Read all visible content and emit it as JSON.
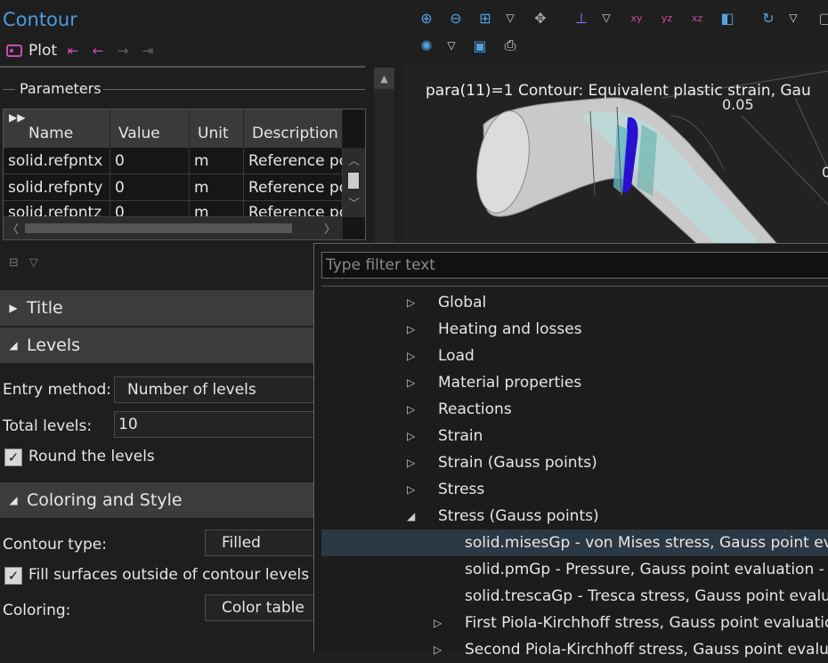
{
  "settings": {
    "title": "Contour",
    "plot_label": "Plot",
    "parameters_heading": "Parameters",
    "table": {
      "headers": [
        "Name",
        "Value",
        "Unit",
        "Description"
      ],
      "rows": [
        [
          "solid.refpntx",
          "0",
          "m",
          "Reference poi"
        ],
        [
          "solid.refpnty",
          "0",
          "m",
          "Reference poi"
        ],
        [
          "solid.refpntz",
          "0",
          "m",
          "Reference poi"
        ]
      ]
    },
    "sections": {
      "title": "Title",
      "levels": "Levels",
      "coloring": "Coloring and Style"
    },
    "levels": {
      "entry_method_label": "Entry method:",
      "entry_method_value": "Number of levels",
      "total_levels_label": "Total levels:",
      "total_levels_value": "10",
      "round_label": "Round the levels",
      "round_checked": true
    },
    "coloring": {
      "contour_type_label": "Contour type:",
      "contour_type_value": "Filled",
      "fill_label": "Fill surfaces outside of contour levels",
      "fill_checked": true,
      "coloring_label": "Coloring:",
      "coloring_value": "Color table"
    }
  },
  "graphics": {
    "plot_title": "para(11)=1  Contour: Equivalent plastic strain, Gau",
    "tick_a": "0.05",
    "tick_b": "0"
  },
  "popup": {
    "filter_placeholder": "Type filter text",
    "tree": [
      {
        "label": "Global",
        "level": 0,
        "state": "collapsed"
      },
      {
        "label": "Heating and losses",
        "level": 0,
        "state": "collapsed"
      },
      {
        "label": "Load",
        "level": 0,
        "state": "collapsed"
      },
      {
        "label": "Material properties",
        "level": 0,
        "state": "collapsed"
      },
      {
        "label": "Reactions",
        "level": 0,
        "state": "collapsed"
      },
      {
        "label": "Strain",
        "level": 0,
        "state": "collapsed"
      },
      {
        "label": "Strain (Gauss points)",
        "level": 0,
        "state": "collapsed"
      },
      {
        "label": "Stress",
        "level": 0,
        "state": "collapsed"
      },
      {
        "label": "Stress (Gauss points)",
        "level": 0,
        "state": "expanded"
      },
      {
        "label": "solid.misesGp - von Mises stress, Gauss point evalua",
        "level": 1,
        "state": "leaf",
        "selected": true
      },
      {
        "label": "solid.pmGp - Pressure, Gauss point evaluation - N/n",
        "level": 1,
        "state": "leaf"
      },
      {
        "label": "solid.trescaGp - Tresca stress, Gauss point evaluation",
        "level": 1,
        "state": "leaf"
      },
      {
        "label": "First Piola-Kirchhoff stress, Gauss point evaluation -",
        "level": 1,
        "state": "collapsed"
      },
      {
        "label": "Second Piola-Kirchhoff stress, Gauss point evaluatio",
        "level": 1,
        "state": "collapsed"
      }
    ]
  },
  "colors": {
    "accent": "#4d9be0",
    "plot_icon": "#c94fae",
    "selection": "#2b3945"
  },
  "icons": [
    "plot-icon",
    "first-icon",
    "previous-icon",
    "next-icon",
    "last-icon",
    "zoom-in-icon",
    "zoom-out-icon",
    "zoom-box-icon",
    "zoom-extents-icon",
    "axis-orientation-icon",
    "xy-view-icon",
    "yz-view-icon",
    "xz-view-icon",
    "scene-light-icon",
    "rotate-icon",
    "camera-icon",
    "snapshot-icon",
    "print-icon"
  ]
}
